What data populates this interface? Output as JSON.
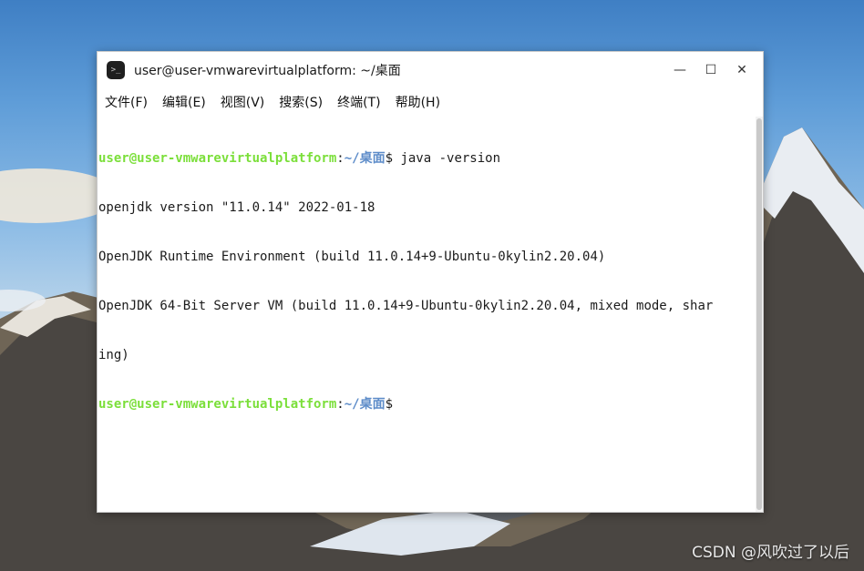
{
  "window": {
    "title": "user@user-vmwarevirtualplatform: ~/桌面",
    "app_icon_glyph": ">_",
    "controls": {
      "minimize": "—",
      "maximize": "☐",
      "close": "✕"
    }
  },
  "menubar": {
    "items": [
      "文件(F)",
      "编辑(E)",
      "视图(V)",
      "搜索(S)",
      "终端(T)",
      "帮助(H)"
    ]
  },
  "terminal": {
    "prompt_user": "user@user-vmwarevirtualplatform",
    "prompt_sep": ":",
    "prompt_path": "~/桌面",
    "prompt_symbol": "$ ",
    "command": "java -version",
    "output": [
      "openjdk version \"11.0.14\" 2022-01-18",
      "OpenJDK Runtime Environment (build 11.0.14+9-Ubuntu-0kylin2.20.04)",
      "OpenJDK 64-Bit Server VM (build 11.0.14+9-Ubuntu-0kylin2.20.04, mixed mode, shar",
      "ing)"
    ]
  },
  "watermark": "CSDN @风吹过了以后",
  "colors": {
    "prompt_user": "#7bdf3a",
    "prompt_path": "#5d8cc9"
  }
}
